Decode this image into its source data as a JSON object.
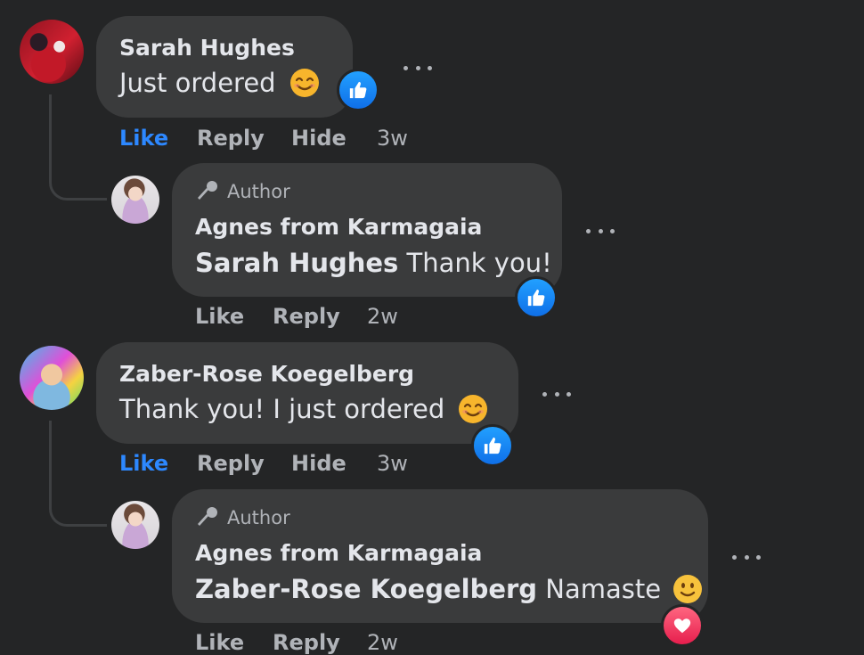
{
  "comments": [
    {
      "author": "Sarah Hughes",
      "text": "Just ordered",
      "emoji": "smiling-face-with-smiling-eyes",
      "reaction": "like",
      "actions": {
        "like": "Like",
        "reply": "Reply",
        "hide": "Hide"
      },
      "liked": true,
      "time": "3w",
      "reply": {
        "badge": "Author",
        "author": "Agnes from Karmagaia",
        "mention": "Sarah Hughes",
        "text": "Thank you!",
        "reaction": "like",
        "actions": {
          "like": "Like",
          "reply": "Reply"
        },
        "time": "2w"
      }
    },
    {
      "author": "Zaber-Rose Koegelberg",
      "text": "Thank you! I just ordered",
      "emoji": "smiling-face-with-smiling-eyes",
      "reaction": "like",
      "actions": {
        "like": "Like",
        "reply": "Reply",
        "hide": "Hide"
      },
      "liked": true,
      "time": "3w",
      "reply": {
        "badge": "Author",
        "author": "Agnes from Karmagaia",
        "mention": "Zaber-Rose Koegelberg",
        "text": "Namaste",
        "emoji": "slightly-smiling-face",
        "reaction": "love",
        "actions": {
          "like": "Like",
          "reply": "Reply"
        },
        "time": "2w"
      }
    }
  ],
  "colors": {
    "background": "#242526",
    "bubble": "#3a3b3c",
    "link_active": "#2d88ff",
    "secondary_text": "#b0b3b8",
    "like_reaction": "#1877f2",
    "love_reaction": "#f33e58"
  }
}
